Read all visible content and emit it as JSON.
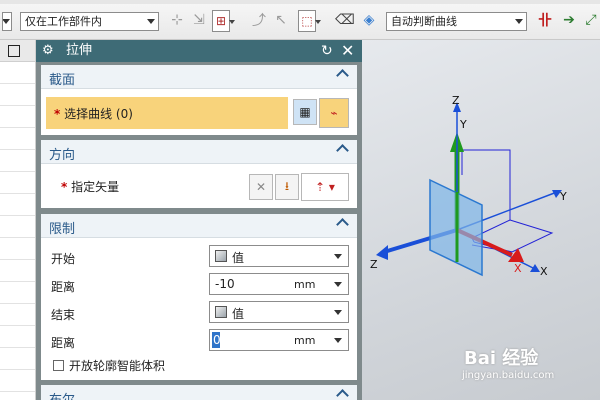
{
  "toolbar": {
    "filter_value": "仅在工作部件内",
    "curve_rule_value": "自动判断曲线"
  },
  "dialog": {
    "title": "拉伸",
    "sections": {
      "section": {
        "label": "截面",
        "select_curve_label": "选择曲线 (0)"
      },
      "direction": {
        "label": "方向",
        "vector_label": "指定矢量"
      },
      "limits": {
        "label": "限制",
        "start_label": "开始",
        "start_type": "值",
        "start_distance_label": "距离",
        "start_distance": "-10",
        "start_unit": "mm",
        "end_label": "结束",
        "end_type": "值",
        "end_distance_label": "距离",
        "end_distance": "0",
        "end_unit": "mm",
        "open_profile_label": "开放轮廓智能体积"
      },
      "boolean": {
        "label": "布尔"
      }
    }
  },
  "viewport": {
    "axis_labels": {
      "z1": "Z",
      "y1": "Y",
      "y2": "Y",
      "z2": "Z",
      "x1": "X",
      "x2": "X"
    },
    "colors": {
      "x_axis": "#d81b1b",
      "y_axis": "#1f9a1f",
      "z_axis": "#1a4fd8",
      "plane": "#7fb6e8"
    }
  },
  "watermark": {
    "logo": "Bai 经验",
    "site": "jingyan.baidu.com"
  }
}
